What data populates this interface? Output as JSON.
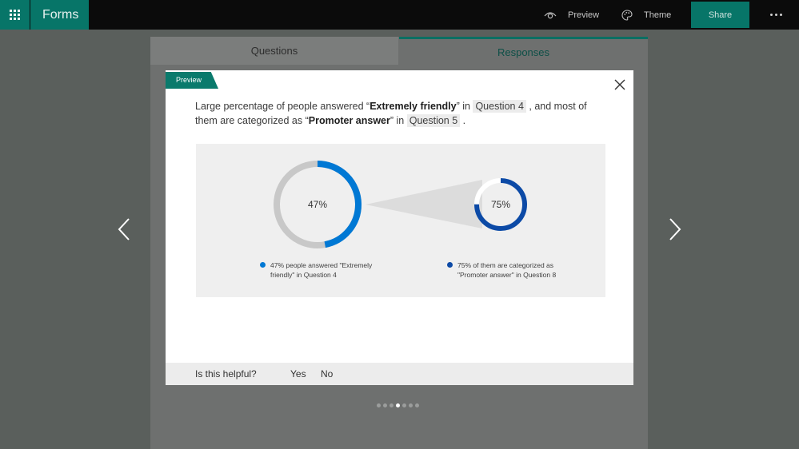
{
  "app": {
    "name": "Forms"
  },
  "toolbar": {
    "preview_label": "Preview",
    "theme_label": "Theme",
    "share_label": "Share"
  },
  "tabs": [
    {
      "label": "Questions"
    },
    {
      "label": "Responses",
      "active": true
    }
  ],
  "dialog": {
    "tag": "Preview",
    "insight": {
      "part1": "Large percentage of people answered “",
      "answer1": "Extremely friendly",
      "part2": "” in ",
      "question1": "Question 4",
      "part3": " , and most of them are categorized as “",
      "answer2": "Promoter answer",
      "part4": "” in ",
      "question2": "Question 5",
      "part5": " ."
    },
    "feedback": {
      "prompt": "Is this helpful?",
      "yes": "Yes",
      "no": "No"
    }
  },
  "chart_data": {
    "type": "pie",
    "charts": [
      {
        "value_percent": 47,
        "label": "47%",
        "legend": "47% people answered \"Extremely friendly\" in Question 4",
        "color": "#0078d4",
        "track_color": "#c8c8c8"
      },
      {
        "value_percent": 75,
        "label": "75%",
        "legend": "75% of them are categorized as \"Promoter answer\" in Question 8",
        "color": "#0c4aa6",
        "track_color": "#ffffff"
      }
    ],
    "legend_placement": "bottom"
  },
  "pagination": {
    "total": 7,
    "current": 4
  },
  "colors": {
    "brand": "#077568",
    "topbar": "#0b0b0b",
    "accent_blue": "#0078d4",
    "dark_blue": "#0c4aa6"
  }
}
